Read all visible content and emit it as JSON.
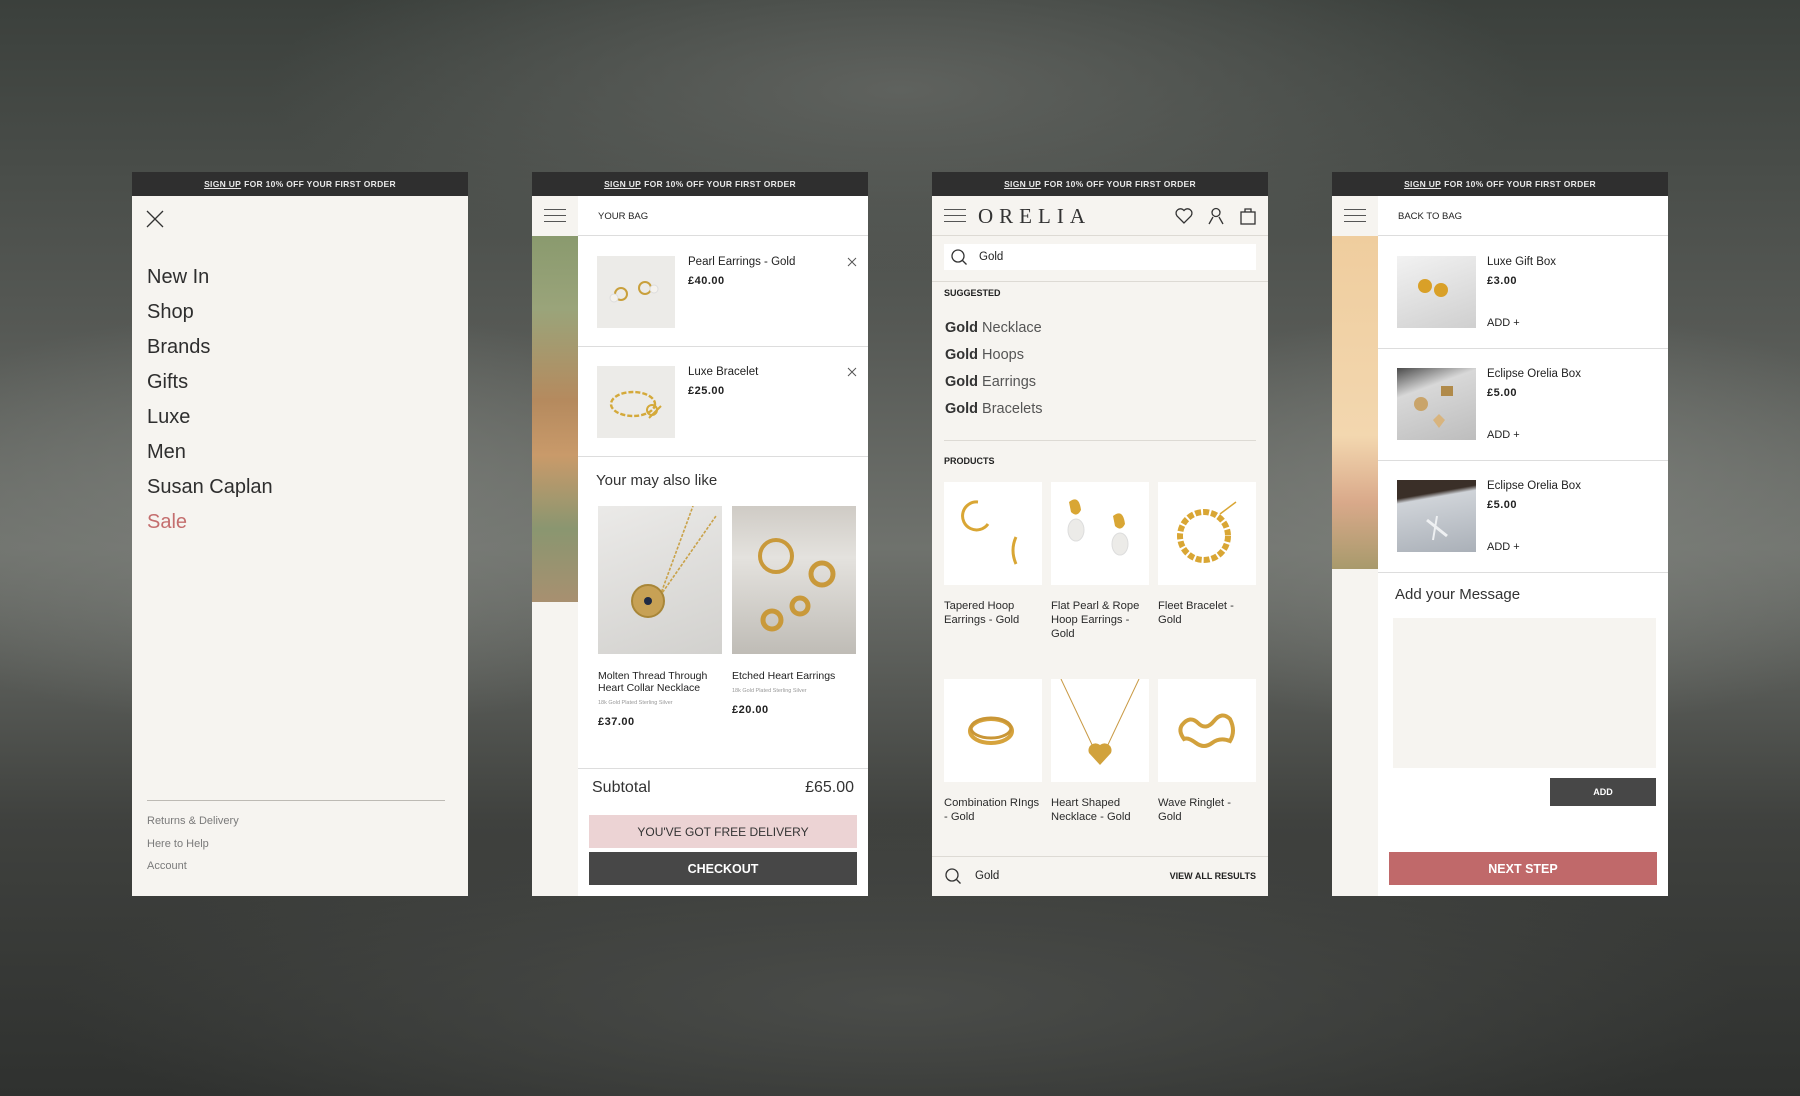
{
  "promo": {
    "link": "SIGN UP",
    "text": "FOR 10% OFF YOUR FIRST ORDER"
  },
  "menu_panel": {
    "nav_items": [
      "New In",
      "Shop",
      "Brands",
      "Gifts",
      "Luxe",
      "Men",
      "Susan Caplan",
      "Sale"
    ],
    "footer_links": [
      "Returns & Delivery",
      "Here to Help",
      "Account"
    ]
  },
  "bag_panel": {
    "title": "YOUR BAG",
    "items": [
      {
        "name": "Pearl Earrings - Gold",
        "price": "£40.00"
      },
      {
        "name": "Luxe Bracelet",
        "price": "£25.00"
      }
    ],
    "recommend_title": "Your may also like",
    "recommendations": [
      {
        "name": "Molten Thread Through Heart Collar Necklace",
        "material": "18k Gold Plated Sterling Silver",
        "price": "£37.00"
      },
      {
        "name": "Etched Heart Earrings",
        "material": "18k Gold Plated Sterling Silver",
        "price": "£20.00"
      }
    ],
    "subtotal_label": "Subtotal",
    "subtotal_value": "£65.00",
    "free_delivery": "YOU'VE GOT FREE DELIVERY",
    "checkout": "CHECKOUT"
  },
  "search_panel": {
    "logo": "ORELIA",
    "query": "Gold",
    "suggested_label": "SUGGESTED",
    "suggestions": [
      {
        "bold": "Gold",
        "rest": " Necklace"
      },
      {
        "bold": "Gold",
        "rest": " Hoops"
      },
      {
        "bold": "Gold",
        "rest": " Earrings"
      },
      {
        "bold": "Gold",
        "rest": " Bracelets"
      }
    ],
    "products_label": "PRODUCTS",
    "products": [
      "Tapered Hoop Earrings - Gold",
      "Flat Pearl & Rope Hoop Earrings - Gold",
      "Fleet Bracelet - Gold",
      "Combination RIngs - Gold",
      "Heart Shaped Necklace - Gold",
      "Wave Ringlet - Gold"
    ],
    "view_all": "VIEW ALL RESULTS"
  },
  "gift_panel": {
    "title": "BACK TO BAG",
    "items": [
      {
        "name": "Luxe Gift Box",
        "price": "£3.00",
        "action": "ADD +"
      },
      {
        "name": "Eclipse Orelia Box",
        "price": "£5.00",
        "action": "ADD +"
      },
      {
        "name": "Eclipse Orelia Box",
        "price": "£5.00",
        "action": "ADD +"
      }
    ],
    "message_title": "Add your Message",
    "message_value": "",
    "add_button": "ADD",
    "next_step": "NEXT STEP"
  },
  "colors": {
    "promo_bar": "#2f2f2f",
    "panel_bg": "#f6f4f0",
    "sale": "#c46e6e",
    "free_delivery_bg": "#ecd3d4",
    "dark_button": "#474747",
    "next_step": "#c0696a"
  }
}
